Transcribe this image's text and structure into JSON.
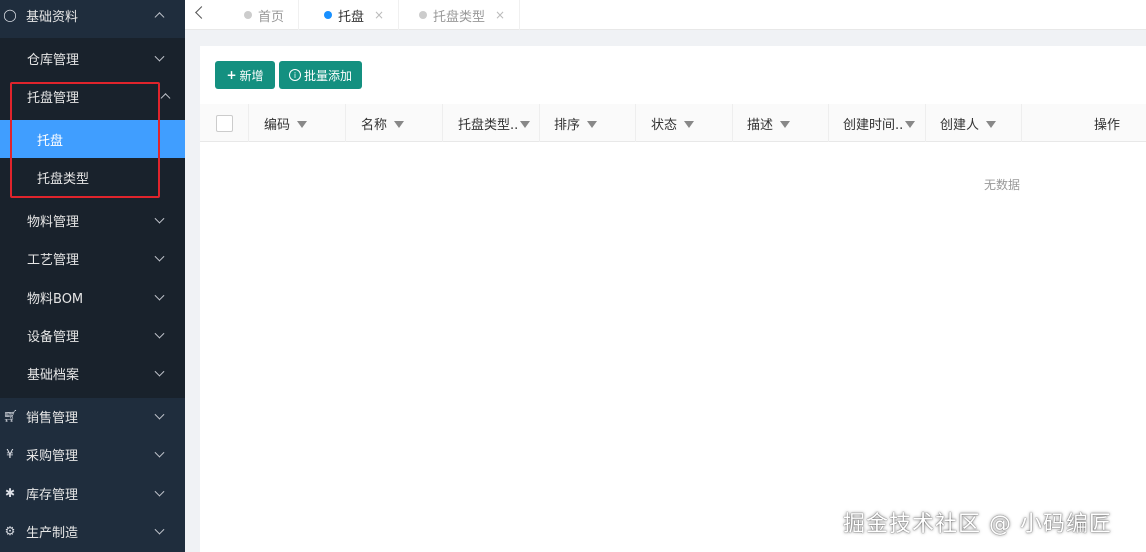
{
  "sidebar": {
    "top_group": {
      "label": "基础资料",
      "icon": "bulb-icon"
    },
    "sub_items": [
      {
        "label": "仓库管理"
      },
      {
        "label": "托盘管理"
      },
      {
        "label": "托盘"
      },
      {
        "label": "托盘类型"
      },
      {
        "label": "物料管理"
      },
      {
        "label": "工艺管理"
      },
      {
        "label": "物料BOM"
      },
      {
        "label": "设备管理"
      },
      {
        "label": "基础档案"
      }
    ],
    "groups": [
      {
        "label": "销售管理",
        "icon": "cart-icon"
      },
      {
        "label": "采购管理",
        "icon": "yen-icon"
      },
      {
        "label": "库存管理",
        "icon": "asterisk-icon"
      },
      {
        "label": "生产制造",
        "icon": "gear-icon"
      }
    ],
    "accent_color": "#409eff"
  },
  "tabs": [
    {
      "label": "首页"
    },
    {
      "label": "托盘"
    },
    {
      "label": "托盘类型"
    }
  ],
  "toolbar": {
    "add_label": "新增",
    "batch_label": "批量添加",
    "button_color": "#149080"
  },
  "table": {
    "columns": [
      "编码",
      "名称",
      "托盘类型..",
      "排序",
      "状态",
      "描述",
      "创建时间..",
      "创建人",
      "操作"
    ],
    "empty_text": "无数据"
  },
  "watermark": "掘金技术社区 @ 小码编匠"
}
